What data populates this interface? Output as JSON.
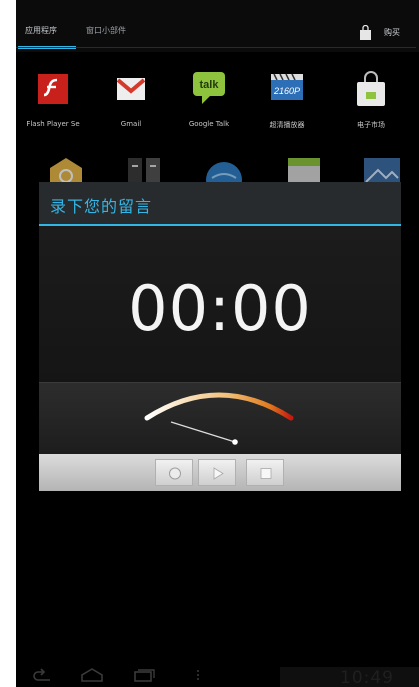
{
  "launcher": {
    "tabs": [
      {
        "label": "应用程序",
        "active": true
      },
      {
        "label": "窗口小部件",
        "active": false
      }
    ],
    "shop_label": "购买"
  },
  "apps": [
    {
      "label": "Flash Player Se",
      "icon": "flash-player-icon"
    },
    {
      "label": "Gmail",
      "icon": "gmail-icon"
    },
    {
      "label": "Google Talk",
      "icon": "google-talk-icon"
    },
    {
      "label": "超清播放器",
      "icon": "video-player-icon"
    },
    {
      "label": "电子市场",
      "icon": "market-icon"
    }
  ],
  "dialog": {
    "title": "录下您的留言",
    "timer": "00:00",
    "controls": {
      "record": "record-icon",
      "play": "play-icon",
      "stop": "stop-icon"
    }
  },
  "status": {
    "clock": "10:49"
  },
  "colors": {
    "accent": "#33b5e5",
    "background": "#000000"
  }
}
